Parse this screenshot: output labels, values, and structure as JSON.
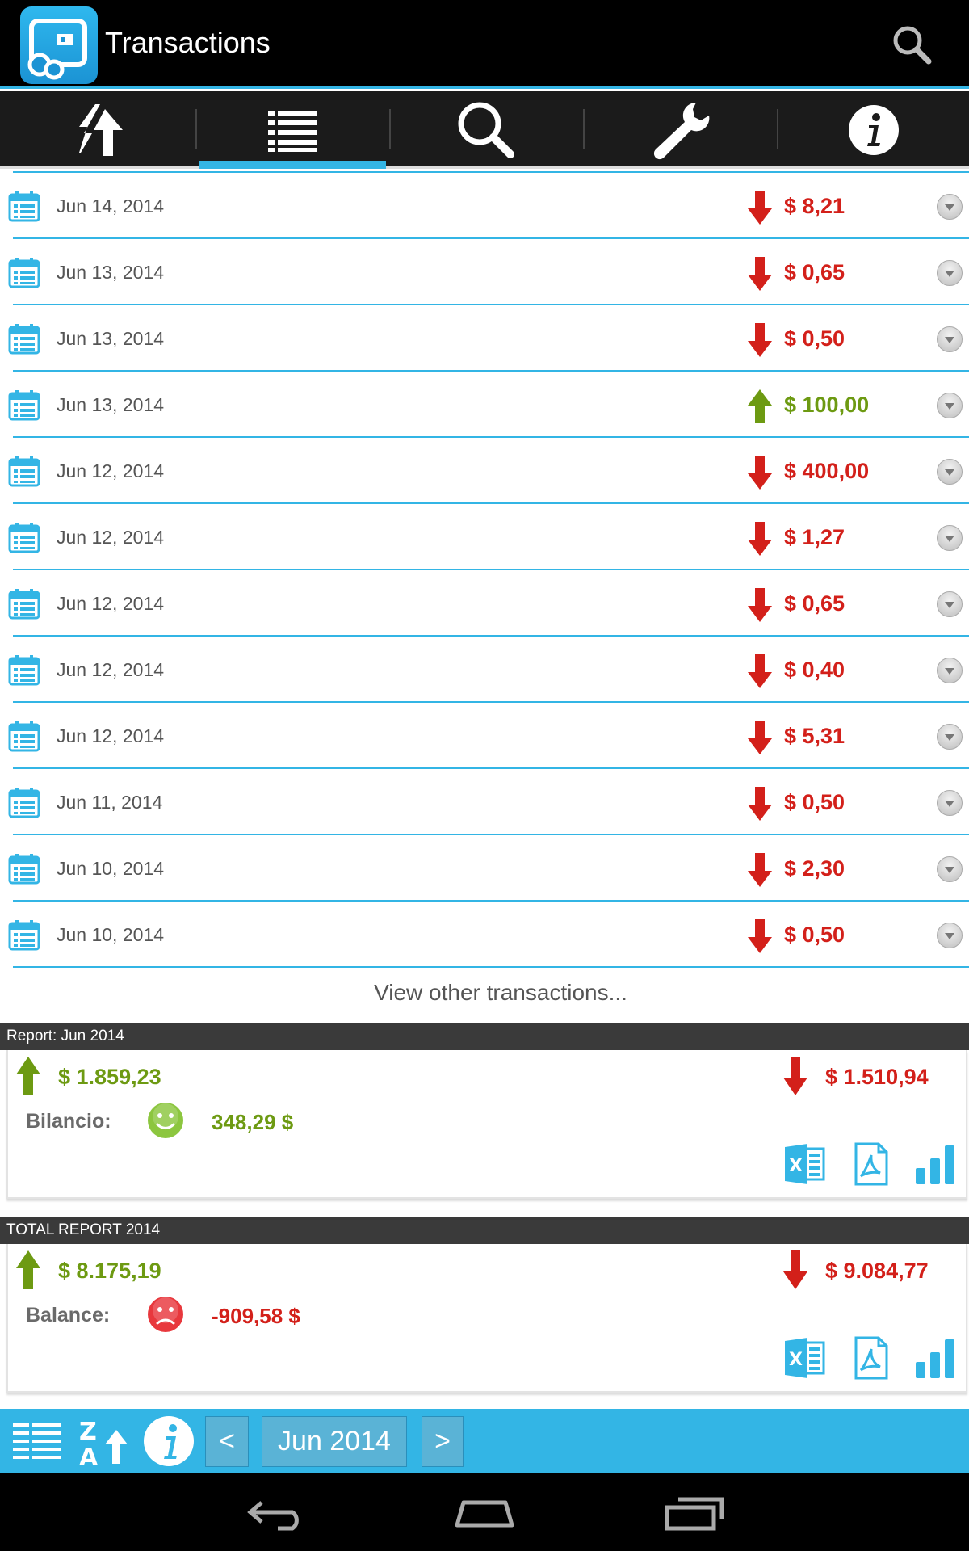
{
  "app": {
    "title": "Transactions"
  },
  "colors": {
    "accent": "#33b5e5",
    "income": "#6d9a12",
    "expense": "#d3201a"
  },
  "tabs": [
    {
      "name": "sync",
      "icon": "sync-arrows-icon",
      "active": false
    },
    {
      "name": "list",
      "icon": "list-icon",
      "active": true
    },
    {
      "name": "search",
      "icon": "search-icon",
      "active": false
    },
    {
      "name": "tools",
      "icon": "wrench-icon",
      "active": false
    },
    {
      "name": "info",
      "icon": "info-icon",
      "active": false
    }
  ],
  "transactions": [
    {
      "date": "Jun 14, 2014",
      "amount": "$ 8,21",
      "type": "expense"
    },
    {
      "date": "Jun 13, 2014",
      "amount": "$ 0,65",
      "type": "expense"
    },
    {
      "date": "Jun 13, 2014",
      "amount": "$ 0,50",
      "type": "expense"
    },
    {
      "date": "Jun 13, 2014",
      "amount": "$ 100,00",
      "type": "income"
    },
    {
      "date": "Jun 12, 2014",
      "amount": "$ 400,00",
      "type": "expense"
    },
    {
      "date": "Jun 12, 2014",
      "amount": "$ 1,27",
      "type": "expense"
    },
    {
      "date": "Jun 12, 2014",
      "amount": "$ 0,65",
      "type": "expense"
    },
    {
      "date": "Jun 12, 2014",
      "amount": "$ 0,40",
      "type": "expense"
    },
    {
      "date": "Jun 12, 2014",
      "amount": "$ 5,31",
      "type": "expense"
    },
    {
      "date": "Jun 11, 2014",
      "amount": "$ 0,50",
      "type": "expense"
    },
    {
      "date": "Jun 10, 2014",
      "amount": "$ 2,30",
      "type": "expense"
    },
    {
      "date": "Jun 10, 2014",
      "amount": "$ 0,50",
      "type": "expense"
    }
  ],
  "view_other": "View other transactions...",
  "reports": [
    {
      "title": "Report: Jun 2014",
      "income": "$ 1.859,23",
      "expense": "$ 1.510,94",
      "balance_label": "Bilancio:",
      "balance": "348,29 $",
      "mood": "happy"
    },
    {
      "title": "TOTAL REPORT 2014",
      "income": "$ 8.175,19",
      "expense": "$ 9.084,77",
      "balance_label": "Balance:",
      "balance": "-909,58 $",
      "mood": "sad"
    }
  ],
  "bottombar": {
    "prev": "<",
    "month": "Jun 2014",
    "next": ">"
  }
}
